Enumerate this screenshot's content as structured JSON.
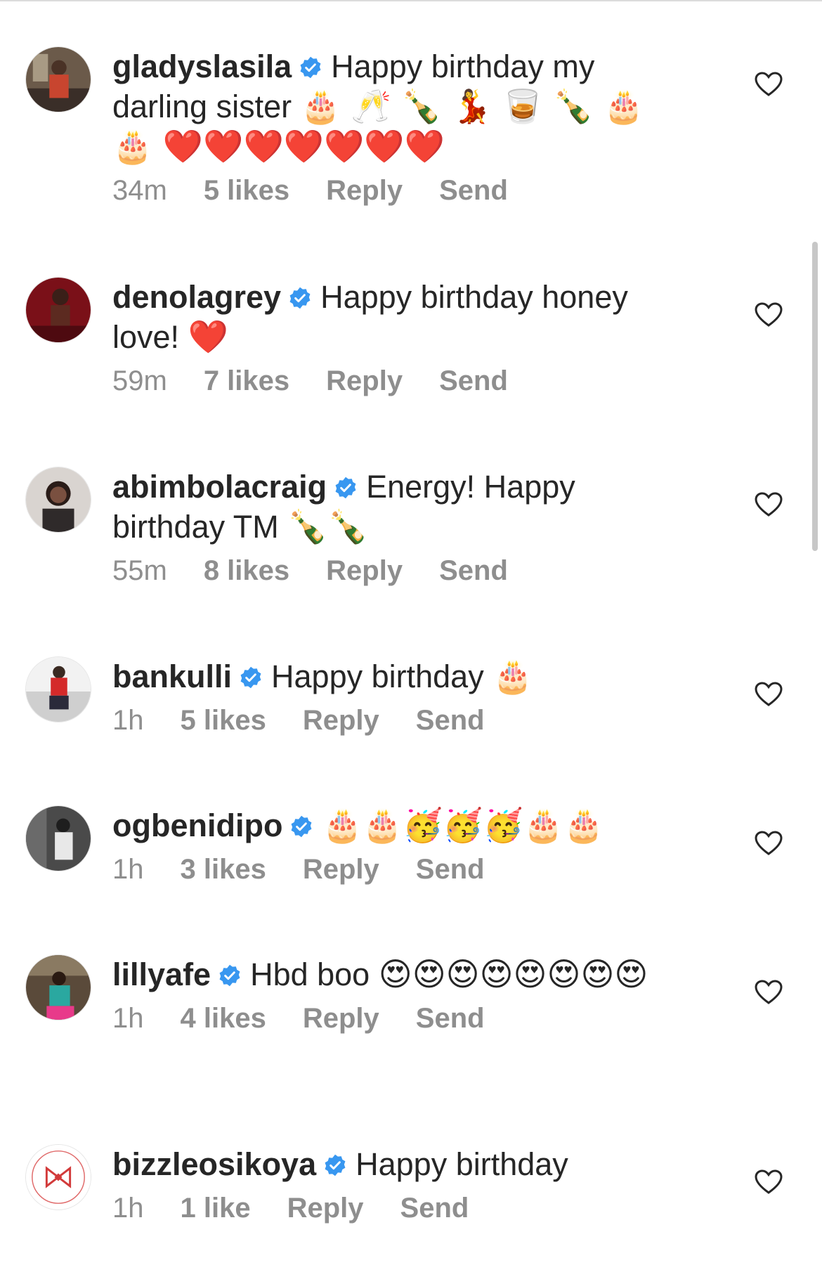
{
  "comments": [
    {
      "username": "gladyslasila",
      "text": "Happy birthday my darling sister",
      "emojis": "🎂 🥂 🍾 💃 🥃 🍾 🎂 🎂 ❤️❤️❤️❤️❤️❤️❤️",
      "time": "34m",
      "likes": "5 likes",
      "reply": "Reply",
      "send": "Send"
    },
    {
      "username": "denolagrey",
      "text": "Happy birthday honey love!",
      "emojis": "❤️",
      "time": "59m",
      "likes": "7 likes",
      "reply": "Reply",
      "send": "Send"
    },
    {
      "username": "abimbolacraig",
      "text": "Energy! Happy birthday TM",
      "emojis": "🍾🍾",
      "time": "55m",
      "likes": "8 likes",
      "reply": "Reply",
      "send": "Send"
    },
    {
      "username": "bankulli",
      "text": "Happy birthday",
      "emojis": "🎂",
      "time": "1h",
      "likes": "5 likes",
      "reply": "Reply",
      "send": "Send"
    },
    {
      "username": "ogbenidipo",
      "text": "",
      "emojis": "🎂🎂🥳🥳🥳🎂🎂",
      "time": "1h",
      "likes": "3 likes",
      "reply": "Reply",
      "send": "Send"
    },
    {
      "username": "lillyafe",
      "text": "Hbd boo",
      "emojis": "😍😍😍😍😍😍😍😍",
      "time": "1h",
      "likes": "4 likes",
      "reply": "Reply",
      "send": "Send"
    },
    {
      "username": "bizzleosikoya",
      "text": "Happy birthday",
      "emojis": "",
      "time": "1h",
      "likes": "1 like",
      "reply": "Reply",
      "send": "Send"
    }
  ],
  "colors": {
    "verified": "#3897f0",
    "meta_text": "#8e8e8e",
    "text": "#262626"
  },
  "icons": {
    "verified": "verified-badge-icon",
    "like": "heart-outline-icon"
  }
}
